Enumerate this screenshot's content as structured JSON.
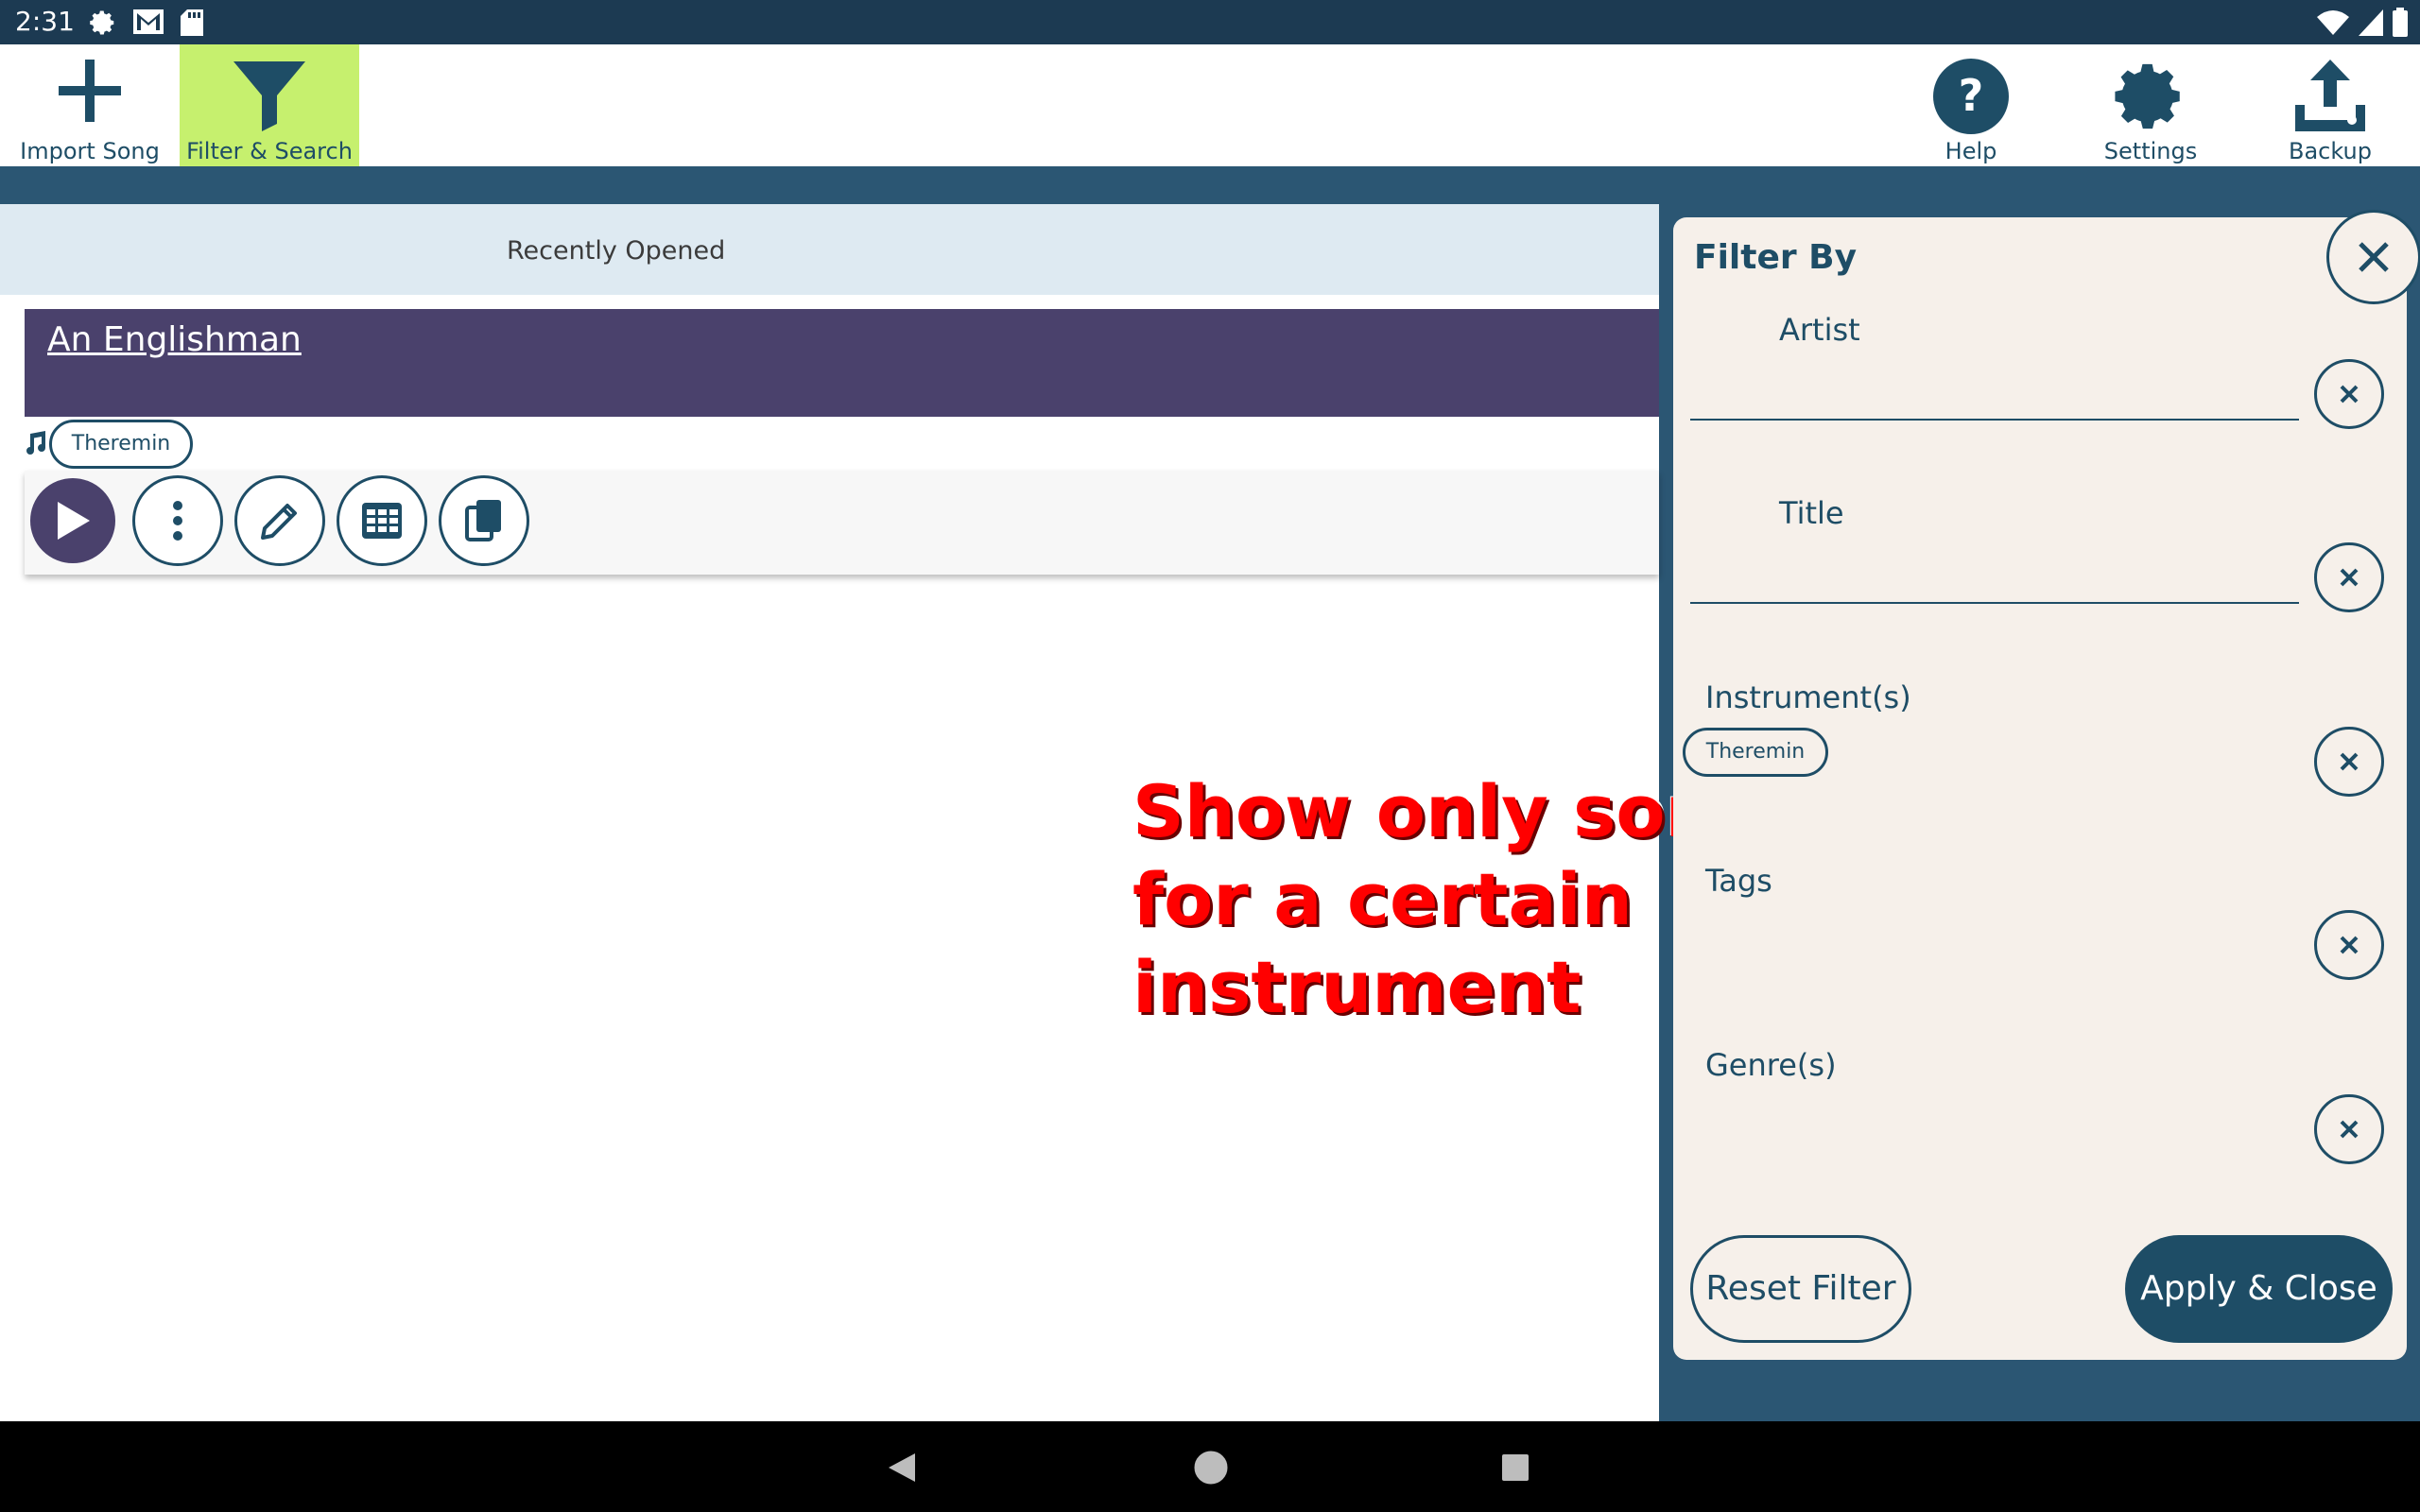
{
  "status_bar": {
    "time": "2:31"
  },
  "toolbar": {
    "import_song": "Import Song",
    "filter_search": "Filter & Search",
    "help": "Help",
    "settings": "Settings",
    "backup": "Backup",
    "active_color": "#c6f06e"
  },
  "main": {
    "recently_opened": "Recently Opened",
    "song": {
      "title": "An Englishman",
      "instrument_chip": "Theremin"
    }
  },
  "annotation": {
    "line1": "Show only songs",
    "line2": "for a certain",
    "line3": "instrument"
  },
  "filter_panel": {
    "title": "Filter By",
    "fields": {
      "artist": "Artist",
      "title": "Title",
      "instruments": "Instrument(s)",
      "instrument_chip": "Theremin",
      "tags": "Tags",
      "genres": "Genre(s)"
    },
    "reset_label": "Reset Filter",
    "apply_label": "Apply & Close"
  },
  "colors": {
    "primary": "#1e4d66",
    "card": "#4a416c",
    "panel_bg": "#f6f0ea",
    "annotation": "#ff0000"
  }
}
